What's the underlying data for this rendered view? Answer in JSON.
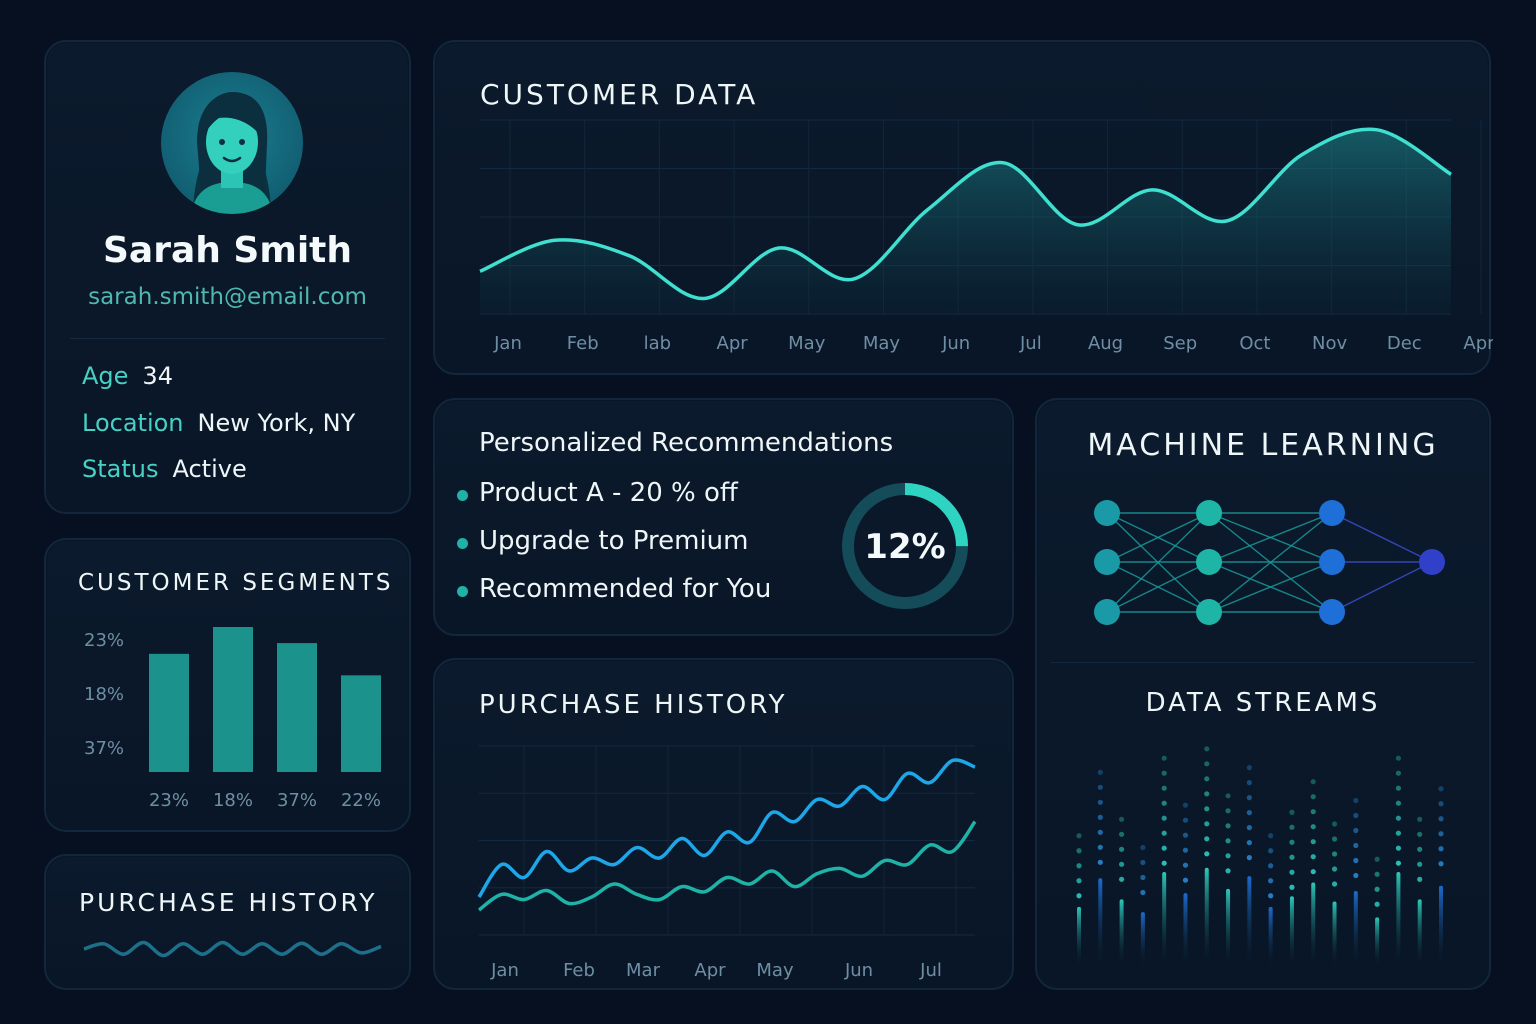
{
  "profile": {
    "name": "Sarah Smith",
    "email": "sarah.smith@email.com",
    "fields": [
      {
        "label": "Age",
        "value": "34"
      },
      {
        "label": "Location",
        "value": "New York, NY"
      },
      {
        "label": "Status",
        "value": "Active"
      }
    ],
    "avatar_icon": "user-avatar-icon"
  },
  "segments": {
    "title": "CUSTOMER SEGMENTS",
    "chart_data": {
      "type": "bar",
      "categories": [
        "23%",
        "18%",
        "37%",
        "22%"
      ],
      "values": [
        22,
        27,
        24,
        18
      ],
      "y_tick_labels": [
        "23%",
        "18%",
        "37%"
      ],
      "color": "#1fa89c"
    }
  },
  "purchase_small": {
    "title": "PURCHASE HISTORY",
    "sparkline": [
      0.5,
      0.7,
      0.3,
      0.75,
      0.25,
      0.7,
      0.3,
      0.75,
      0.3,
      0.7,
      0.3,
      0.72,
      0.3,
      0.7,
      0.35,
      0.6
    ]
  },
  "customer_data": {
    "title": "CUSTOMER DATA",
    "chart_data": {
      "type": "area",
      "categories": [
        "Jan",
        "Feb",
        "lab",
        "Apr",
        "May",
        "May",
        "Jun",
        "Jul",
        "Aug",
        "Sep",
        "Oct",
        "Nov",
        "Dec",
        "Apr"
      ],
      "values": [
        22,
        38,
        30,
        8,
        34,
        18,
        54,
        78,
        46,
        64,
        48,
        82,
        95,
        72
      ],
      "ylim": [
        0,
        100
      ],
      "grid": true,
      "color": "#3fe0d0"
    }
  },
  "recommendations": {
    "title": "Personalized Recommendations",
    "items": [
      "Product A - 20 % off",
      "Upgrade to Premium",
      "Recommended for You"
    ],
    "progress_label": "12%",
    "progress_fraction": 0.25
  },
  "purchase_history": {
    "title": "PURCHASE HISTORY",
    "chart_data": {
      "type": "line",
      "categories": [
        "Jan",
        "Feb",
        "Mar",
        "Apr",
        "May",
        "Jun",
        "Jul"
      ],
      "series": [
        {
          "values": [
            20,
            45,
            35,
            55,
            40,
            50,
            45,
            58,
            50,
            65,
            52,
            70,
            62,
            85,
            78,
            95,
            90,
            105,
            95,
            115,
            108,
            125,
            120
          ]
        },
        {
          "values": [
            10,
            22,
            18,
            25,
            15,
            20,
            30,
            22,
            18,
            28,
            24,
            35,
            30,
            40,
            28,
            38,
            42,
            36,
            48,
            45,
            60,
            55,
            78
          ]
        }
      ],
      "colors": [
        "#1ea7e8",
        "#1fb3a8"
      ],
      "grid": true
    }
  },
  "machine_learning": {
    "title": "MACHINE LEARNING",
    "icon": "neural-network-icon"
  },
  "data_streams": {
    "title": "DATA STREAMS",
    "columns": [
      0.55,
      0.82,
      0.62,
      0.5,
      0.88,
      0.68,
      0.92,
      0.72,
      0.84,
      0.55,
      0.65,
      0.78,
      0.6,
      0.7,
      0.45,
      0.88,
      0.62,
      0.75
    ]
  }
}
